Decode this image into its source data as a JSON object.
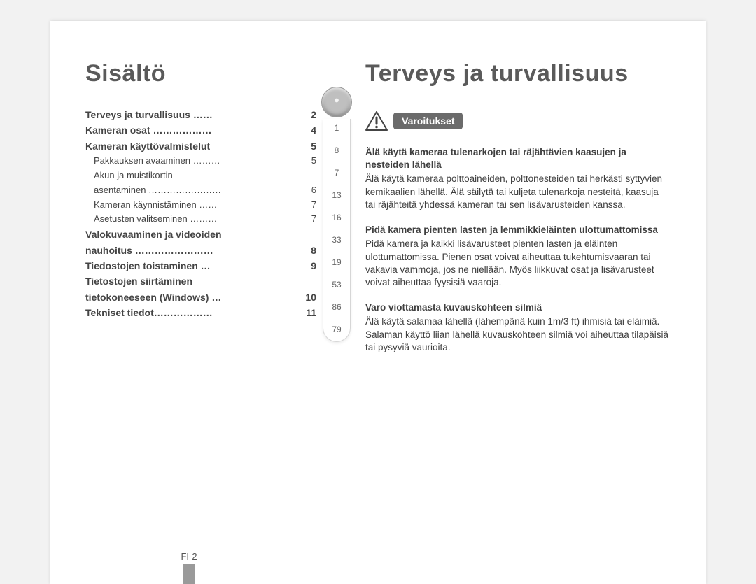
{
  "left_title": "Sisältö",
  "right_title": "Terveys ja turvallisuus",
  "toc": [
    {
      "label": "Terveys ja turvallisuus ……",
      "page": "2",
      "bold": true
    },
    {
      "label": "Kameran osat ………………",
      "page": "4",
      "bold": true
    },
    {
      "label": "Kameran käyttövalmistelut",
      "page": "5",
      "bold": true
    },
    {
      "label": "Pakkauksen avaaminen ………",
      "page": "5",
      "bold": false,
      "sub": true
    },
    {
      "label": "Akun ja muistikortin",
      "page": "",
      "bold": false,
      "sub": true
    },
    {
      "label": "asentaminen ……………………",
      "page": "6",
      "bold": false,
      "sub": true
    },
    {
      "label": "Kameran käynnistäminen ……",
      "page": "7",
      "bold": false,
      "sub": true
    },
    {
      "label": "Asetusten valitseminen ………",
      "page": "7",
      "bold": false,
      "sub": true
    },
    {
      "label": "Valokuvaaminen ja videoiden",
      "page": "",
      "bold": true
    },
    {
      "label": "nauhoitus ……………………",
      "page": "8",
      "bold": true
    },
    {
      "label": "Tiedostojen toistaminen …",
      "page": "9",
      "bold": true
    },
    {
      "label": "Tietostojen siirtäminen",
      "page": "",
      "bold": true
    },
    {
      "label": "tietokoneeseen (Windows) …",
      "page": "10",
      "bold": true
    },
    {
      "label": "Tekniset tiedot………………",
      "page": "11",
      "bold": true
    }
  ],
  "scroll_numbers": [
    "1",
    "8",
    "7",
    "13",
    "16",
    "33",
    "19",
    "53",
    "86",
    "79"
  ],
  "warning_label": "Varoitukset",
  "blocks": [
    {
      "hd": "Älä käytä kameraa tulenarkojen tai räjähtävien kaasujen ja nesteiden lähellä",
      "body": "Älä käytä kameraa polttoaineiden, polttonesteiden tai herkästi syttyvien kemikaalien lähellä. Älä säilytä tai kuljeta tulenarkoja nesteitä, kaasuja tai räjähteitä yhdessä kameran tai sen lisävarusteiden kanssa."
    },
    {
      "hd": "Pidä kamera pienten lasten ja lemmikkieläinten ulottumattomissa",
      "body": "Pidä kamera ja kaikki lisävarusteet pienten lasten ja eläinten ulottumattomissa. Pienen osat voivat aiheuttaa tukehtumisvaaran tai vakavia vammoja, jos ne niellään. Myös liikkuvat osat ja lisävarusteet voivat aiheuttaa fyysisiä vaaroja."
    },
    {
      "hd": "Varo viottamasta kuvauskohteen silmiä",
      "body": "Älä käytä salamaa lähellä (lähempänä kuin 1m/3 ft) ihmisiä tai eläimiä. Salaman käyttö liian lähellä kuvauskohteen silmiä voi aiheuttaa tilapäisiä tai pysyviä vaurioita."
    }
  ],
  "page_number": "FI-2"
}
